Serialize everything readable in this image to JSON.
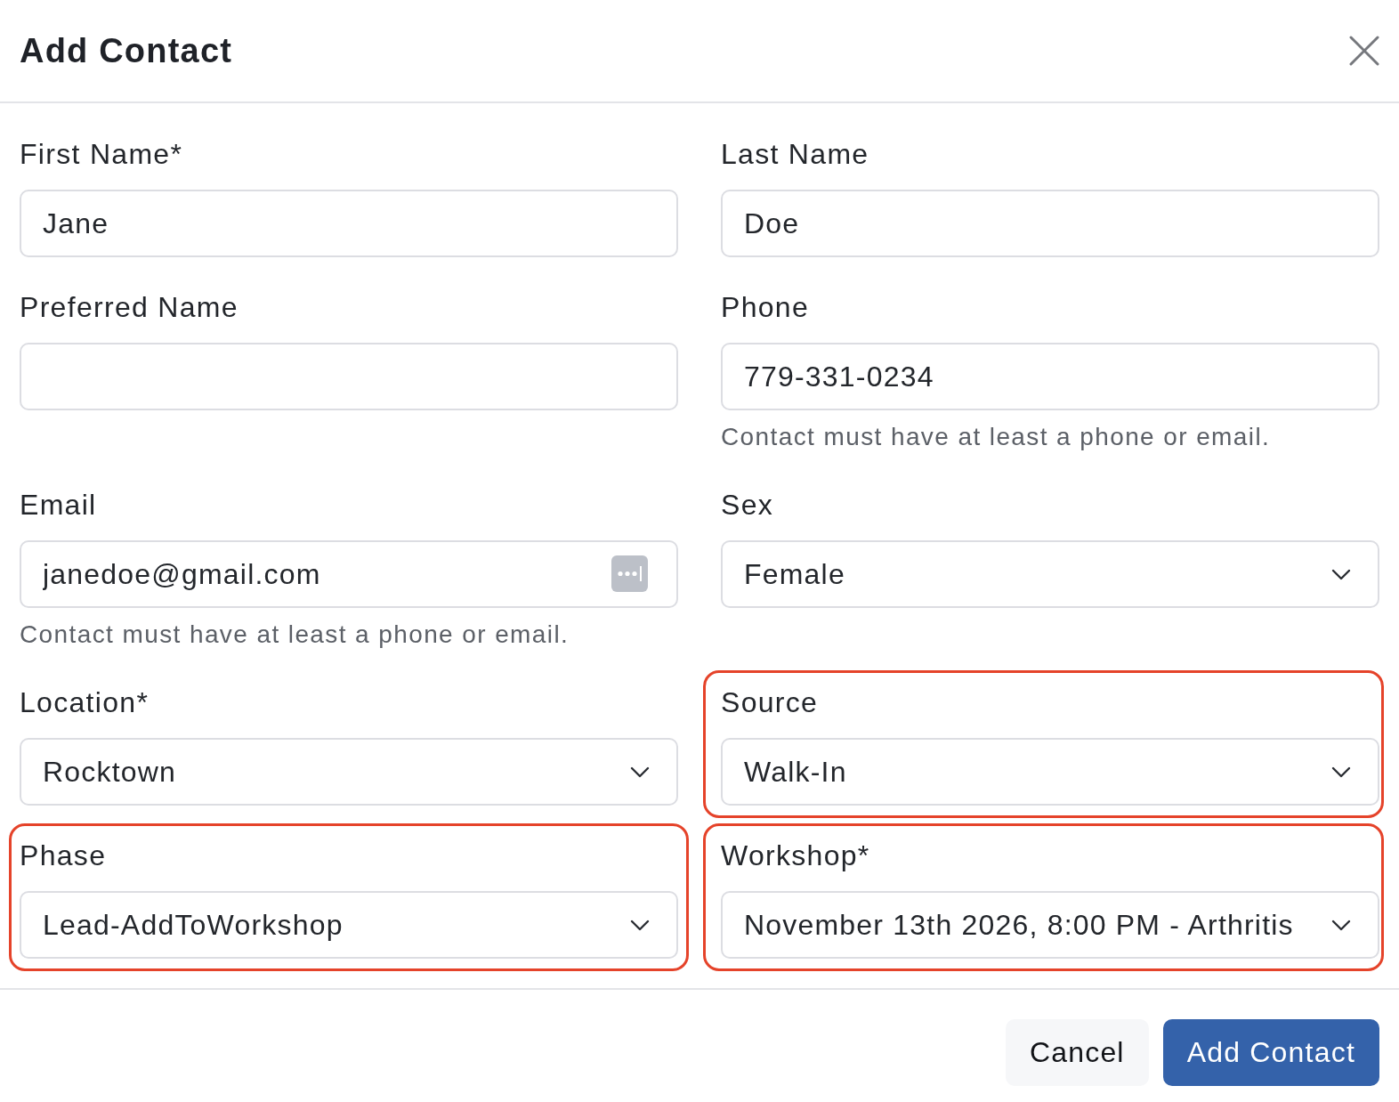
{
  "dialog": {
    "title": "Add Contact"
  },
  "form": {
    "fields": [
      {
        "kind": "text",
        "label": "First Name*",
        "value": "Jane",
        "highlighted": false
      },
      {
        "kind": "text",
        "label": "Last Name",
        "value": "Doe",
        "highlighted": false
      },
      {
        "kind": "text",
        "label": "Preferred Name",
        "highlighted": false
      },
      {
        "kind": "text",
        "label": "Phone",
        "value": "779-331-0234",
        "helper": "Contact must have at least a phone or email.",
        "highlighted": false
      },
      {
        "kind": "text",
        "label": "Email",
        "value": "janedoe@gmail.com",
        "autofill_button": true,
        "helper": "Contact must have at least a phone or email.",
        "highlighted": false
      },
      {
        "kind": "select",
        "label": "Sex",
        "value": "Female",
        "highlighted": false
      },
      {
        "kind": "select",
        "label": "Location*",
        "value": "Rocktown",
        "highlighted": false
      },
      {
        "kind": "select",
        "label": "Source",
        "value": "Walk-In",
        "highlighted": true
      },
      {
        "kind": "select",
        "label": "Phase",
        "value": "Lead-AddToWorkshop",
        "highlighted": true
      },
      {
        "kind": "select",
        "label": "Workshop*",
        "value": "November 13th 2026, 8:00 PM - Arthritis",
        "highlighted": true
      }
    ]
  },
  "buttons": [
    {
      "kind": "secondary",
      "label": "Cancel"
    },
    {
      "kind": "primary",
      "label": "Add Contact"
    }
  ]
}
